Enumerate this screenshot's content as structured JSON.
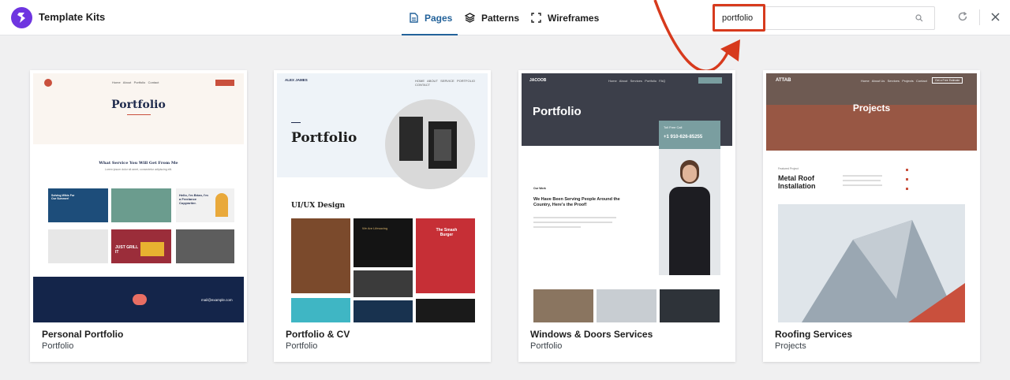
{
  "app": {
    "title": "Template Kits"
  },
  "tabs": [
    {
      "label": "Pages",
      "active": true
    },
    {
      "label": "Patterns",
      "active": false
    },
    {
      "label": "Wireframes",
      "active": false
    }
  ],
  "search": {
    "value": "portfolio"
  },
  "colors": {
    "accent": "#23629a",
    "brand": "#6e35e0",
    "annotation": "#d73a1d"
  },
  "cards": [
    {
      "name": "Personal Portfolio",
      "category": "Portfolio",
      "preview": {
        "heading": "Portfolio",
        "section_title": "What Service You Will Get From Me",
        "section_sub": "Lorem ipsum dolor sit amet, consectetur adipiscing elit.",
        "tile1": "Solving Wikis For Our Summer!",
        "tile2": "Hello, I'm Brian, I'm a Freelance Copywriter.",
        "tile3": "JUST GRILL IT",
        "email": "mail@example.com"
      }
    },
    {
      "name": "Portfolio & CV",
      "category": "Portfolio",
      "preview": {
        "brand": "ALEX JAMES",
        "heading": "Portfolio",
        "section_title": "UI/UX Design",
        "tile_burger": "The Smash Burger",
        "tile_dark": "We Are Lifesaving"
      }
    },
    {
      "name": "Windows & Doors Services",
      "category": "Portfolio",
      "preview": {
        "brand": "JACOOB",
        "heading": "Portfolio",
        "call_label": "Toll Free Call",
        "phone": "+1 910-626-85255",
        "tagline": "We Have Been Serving People Around the Country, Here's the Proof!",
        "eyebrow": "Our Work"
      }
    },
    {
      "name": "Roofing Services",
      "category": "Projects",
      "preview": {
        "brand": "ATTAB",
        "heading": "Projects",
        "project_title": "Metal Roof Installation",
        "eyebrow": "Featured Project",
        "cta": "Get a Free Estimate"
      }
    }
  ]
}
